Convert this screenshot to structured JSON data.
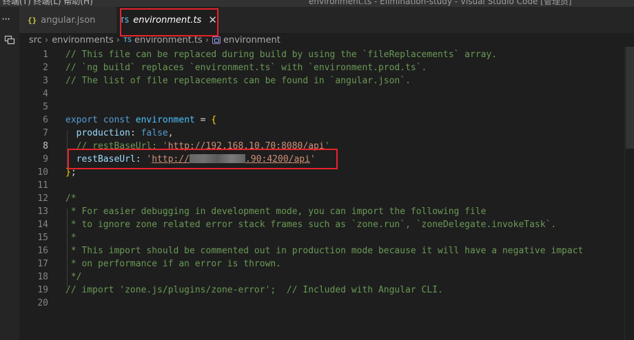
{
  "titlebar": {
    "menu": "终端(T)    终端(L)    帮助(H)",
    "window_title": "environment.ts - Elimination-study - Visual Studio Code [管理员]"
  },
  "activitybar": {
    "more": "···"
  },
  "tabs": [
    {
      "icon": "{}",
      "label": "angular.json",
      "active": false
    },
    {
      "icon": "TS",
      "label": "environment.ts",
      "active": true,
      "close": "✕"
    }
  ],
  "breadcrumb": {
    "items": [
      "src",
      "environments",
      "environment.ts",
      "environment"
    ],
    "separator": "›",
    "ts_icon": "TS"
  },
  "editor": {
    "active_line": 8,
    "lines": [
      {
        "n": "1",
        "tokens": [
          [
            "c",
            "// This file can be replaced during build by using the `fileReplacements` array."
          ]
        ]
      },
      {
        "n": "2",
        "tokens": [
          [
            "c",
            "// `ng build` replaces `environment.ts` with `environment.prod.ts`."
          ]
        ]
      },
      {
        "n": "3",
        "tokens": [
          [
            "c",
            "// The list of file replacements can be found in `angular.json`."
          ]
        ]
      },
      {
        "n": "4",
        "tokens": []
      },
      {
        "n": "5",
        "tokens": []
      },
      {
        "n": "6",
        "tokens": [
          [
            "k",
            "export"
          ],
          [
            "o",
            " "
          ],
          [
            "k",
            "const"
          ],
          [
            "o",
            " "
          ],
          [
            "v",
            "environment"
          ],
          [
            "o",
            " = "
          ],
          [
            "b",
            "{"
          ]
        ]
      },
      {
        "n": "7",
        "tokens": [
          [
            "o",
            "  "
          ],
          [
            "p",
            "production"
          ],
          [
            "o",
            ": "
          ],
          [
            "k",
            "false"
          ],
          [
            "o",
            ","
          ]
        ]
      },
      {
        "n": "8",
        "tokens": [
          [
            "o",
            "  "
          ],
          [
            "c",
            "// restBaseUrl: '"
          ],
          [
            "u",
            "http://192.168.10.70:8080/api"
          ],
          [
            "c",
            "'"
          ]
        ]
      },
      {
        "n": "9",
        "tokens": [
          [
            "o",
            "  "
          ],
          [
            "p",
            "restBaseUrl"
          ],
          [
            "o",
            ": "
          ],
          [
            "s",
            "'"
          ],
          [
            "u",
            "http://"
          ],
          [
            "mask",
            ""
          ],
          [
            "u",
            ".90:4200/api"
          ],
          [
            "s",
            "'"
          ]
        ]
      },
      {
        "n": "10",
        "tokens": [
          [
            "b",
            "}"
          ],
          [
            "o",
            ";"
          ]
        ]
      },
      {
        "n": "11",
        "tokens": []
      },
      {
        "n": "12",
        "tokens": [
          [
            "c",
            "/*"
          ]
        ]
      },
      {
        "n": "13",
        "tokens": [
          [
            "c",
            " * For easier debugging in development mode, you can import the following file"
          ]
        ]
      },
      {
        "n": "14",
        "tokens": [
          [
            "c",
            " * to ignore zone related error stack frames such as `zone.run`, `zoneDelegate.invokeTask`."
          ]
        ]
      },
      {
        "n": "15",
        "tokens": [
          [
            "c",
            " *"
          ]
        ]
      },
      {
        "n": "16",
        "tokens": [
          [
            "c",
            " * This import should be commented out in production mode because it will have a negative impact"
          ]
        ]
      },
      {
        "n": "17",
        "tokens": [
          [
            "c",
            " * on performance if an error is thrown."
          ]
        ]
      },
      {
        "n": "18",
        "tokens": [
          [
            "c",
            " */"
          ]
        ]
      },
      {
        "n": "19",
        "tokens": [
          [
            "c",
            "// import 'zone.js/plugins/zone-error';  // Included with Angular CLI."
          ]
        ]
      },
      {
        "n": "20",
        "tokens": []
      }
    ]
  },
  "colors": {
    "comment": "#6a9955",
    "keyword": "#569cd6",
    "variable": "#4fc1ff",
    "property": "#9cdcfe",
    "string": "#ce9178",
    "bracket": "#ffd700",
    "annotation_red": "#e8232b"
  },
  "icons": {
    "tab_json": "braces-icon",
    "tab_ts": "typescript-icon",
    "close": "close-icon",
    "breadcrumb_symbol": "symbol-variable-icon",
    "split_editor": "split-editor-icon"
  }
}
